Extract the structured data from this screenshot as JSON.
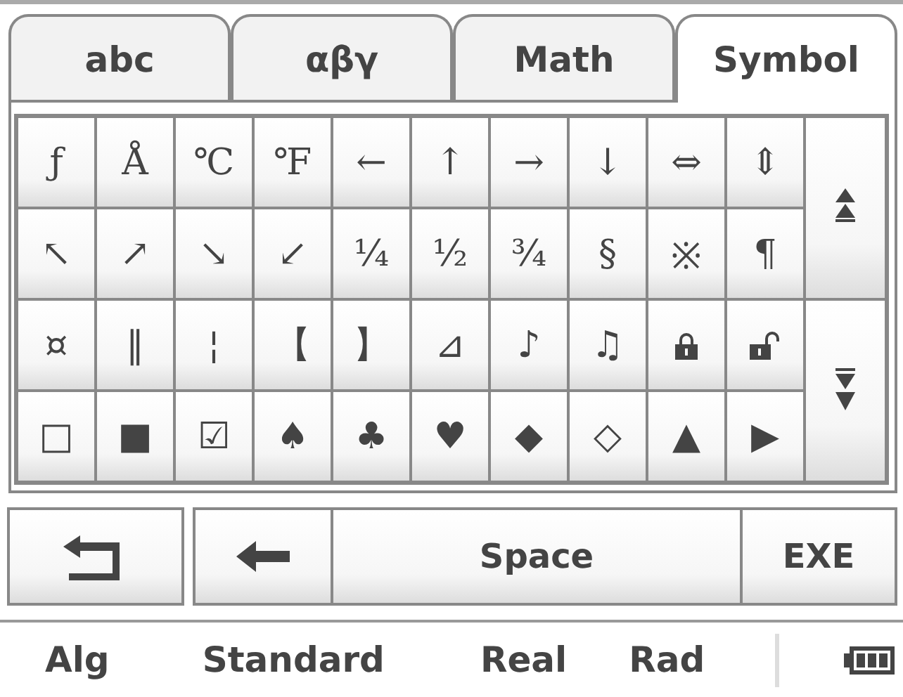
{
  "tabs": [
    {
      "label": "abc",
      "selected": false
    },
    {
      "label": "αβγ",
      "selected": false
    },
    {
      "label": "Math",
      "selected": false
    },
    {
      "label": "Symbol",
      "selected": true
    }
  ],
  "keys": [
    [
      {
        "kind": "char",
        "label": "ƒ"
      },
      {
        "kind": "char",
        "label": "Å"
      },
      {
        "kind": "char",
        "label": "℃"
      },
      {
        "kind": "char",
        "label": "℉"
      },
      {
        "kind": "char",
        "label": "←"
      },
      {
        "kind": "char",
        "label": "↑"
      },
      {
        "kind": "char",
        "label": "→"
      },
      {
        "kind": "char",
        "label": "↓"
      },
      {
        "kind": "char",
        "label": "⇔"
      },
      {
        "kind": "char",
        "label": "⇕"
      }
    ],
    [
      {
        "kind": "char",
        "label": "↖"
      },
      {
        "kind": "char",
        "label": "↗"
      },
      {
        "kind": "char",
        "label": "↘"
      },
      {
        "kind": "char",
        "label": "↙"
      },
      {
        "kind": "char",
        "label": "¼"
      },
      {
        "kind": "char",
        "label": "½"
      },
      {
        "kind": "char",
        "label": "¾"
      },
      {
        "kind": "char",
        "label": "§"
      },
      {
        "kind": "char",
        "label": "※"
      },
      {
        "kind": "char",
        "label": "¶"
      }
    ],
    [
      {
        "kind": "char",
        "label": "¤"
      },
      {
        "kind": "char",
        "label": "‖"
      },
      {
        "kind": "char",
        "label": "¦"
      },
      {
        "kind": "char",
        "label": "【"
      },
      {
        "kind": "char",
        "label": "】"
      },
      {
        "kind": "char",
        "label": "⊿"
      },
      {
        "kind": "char",
        "label": "♪"
      },
      {
        "kind": "char",
        "label": "♫"
      },
      {
        "kind": "lock"
      },
      {
        "kind": "unlock"
      }
    ],
    [
      {
        "kind": "char",
        "label": "□"
      },
      {
        "kind": "char",
        "label": "■"
      },
      {
        "kind": "char",
        "label": "☑"
      },
      {
        "kind": "char",
        "label": "♠"
      },
      {
        "kind": "char",
        "label": "♣"
      },
      {
        "kind": "char",
        "label": "♥"
      },
      {
        "kind": "char",
        "label": "◆"
      },
      {
        "kind": "char",
        "label": "◇"
      },
      {
        "kind": "char",
        "label": "▲"
      },
      {
        "kind": "char",
        "label": "▶"
      }
    ]
  ],
  "bottom": {
    "space": "Space",
    "exe": "EXE"
  },
  "status_bar": [
    "Alg",
    "Standard",
    "Real",
    "Rad"
  ]
}
